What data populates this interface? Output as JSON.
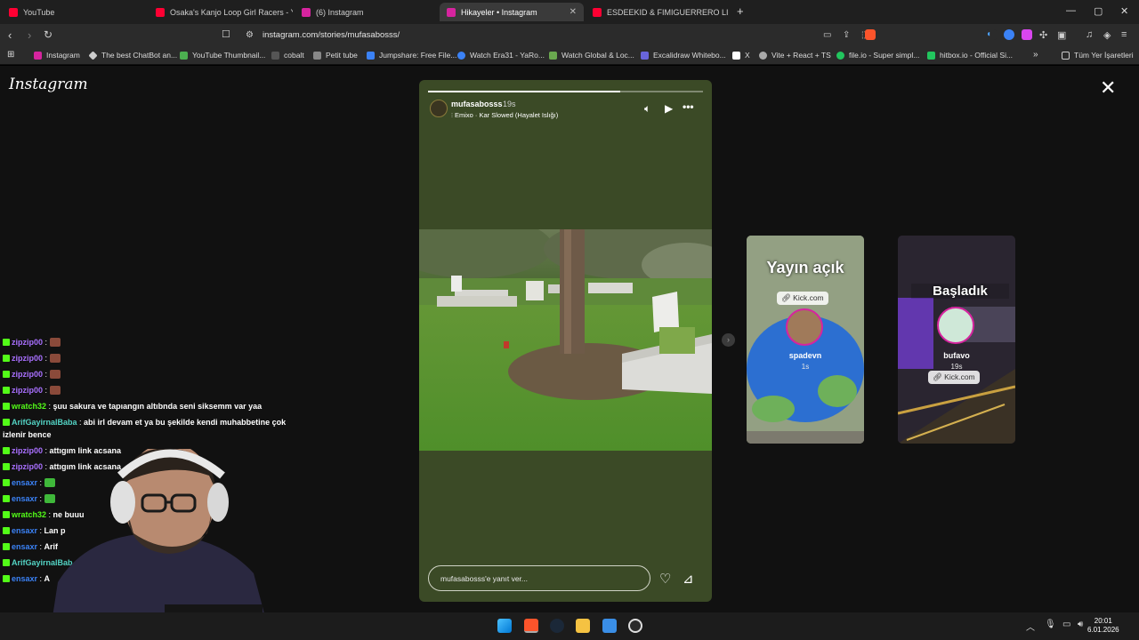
{
  "browser": {
    "tabs": [
      {
        "label": "YouTube",
        "color": "#ff0033"
      },
      {
        "label": "Osaka's Kanjo Loop Girl Racers - You",
        "color": "#ff0033"
      },
      {
        "label": "(6) Instagram",
        "color": "#d6249f"
      },
      {
        "label": "Hikayeler • Instagram",
        "color": "#d6249f",
        "active": true
      },
      {
        "label": "ESDEEKID & FIMIGUERRERO LIVE @",
        "color": "#ff0033"
      }
    ],
    "new_tab": "+",
    "url": "instagram.com/stories/mufasabosss/",
    "bookmarks": [
      {
        "label": "Instagram",
        "color": "#d6249f"
      },
      {
        "label": "The best ChatBot an...",
        "color": "#cccccc"
      },
      {
        "label": "YouTube Thumbnail...",
        "color": "#4caf50"
      },
      {
        "label": "cobalt",
        "color": "#888888"
      },
      {
        "label": "Petit tube",
        "color": "#888888"
      },
      {
        "label": "Jumpshare: Free File...",
        "color": "#3b82f6"
      },
      {
        "label": "Watch Era31 - YaRo...",
        "color": "#3b82f6"
      },
      {
        "label": "Watch Global & Loc...",
        "color": "#6aa84f"
      },
      {
        "label": "Excalidraw Whitebo...",
        "color": "#6965db"
      },
      {
        "label": "X",
        "color": "#ffffff"
      },
      {
        "label": "Vite + React + TS",
        "color": "#aaaaaa"
      },
      {
        "label": "file.io - Super simpl...",
        "color": "#22c55e"
      },
      {
        "label": "hitbox.io - Official Si...",
        "color": "#22c55e"
      }
    ],
    "bookmarks_more": "»",
    "all_bookmarks": "Tüm Yer İşaretleri"
  },
  "instagram": {
    "logo": "Instagram",
    "close": "✕",
    "story": {
      "progress": 0.7,
      "username": "mufasabosss",
      "time": "19s",
      "song": "Emixo · Kar Slowed (Hayalet Islığı)",
      "reply_placeholder": "mufasabosss'e yanıt ver..."
    },
    "side_stories": [
      {
        "title": "Yayın açık",
        "chip": "Kick.com",
        "username": "spadevn",
        "time": "1s"
      },
      {
        "title": "Başladık",
        "chip": "Kick.com",
        "username": "bufavo",
        "time": "19s"
      }
    ]
  },
  "chat": [
    {
      "user": "zipzip00",
      "color": "#a970ff",
      "text": "",
      "emote": true
    },
    {
      "user": "zipzip00",
      "color": "#a970ff",
      "text": "",
      "emote": true
    },
    {
      "user": "zipzip00",
      "color": "#a970ff",
      "text": "",
      "emote": true
    },
    {
      "user": "zipzip00",
      "color": "#a970ff",
      "text": "",
      "emote": true
    },
    {
      "user": "wratch32",
      "color": "#53fc18",
      "text": "şuu sakura ve tapıangın altıbnda seni siksemm var yaa"
    },
    {
      "user": "ArifGayirnalBaba",
      "color": "#53d3c4",
      "text": "abi irl devam et ya bu şekilde kendi muhabbetine çok",
      "cont": "izlenir bence"
    },
    {
      "user": "zipzip00",
      "color": "#a970ff",
      "text": "attıgım link acsana"
    },
    {
      "user": "zipzip00",
      "color": "#a970ff",
      "text": "attıgım link acsana"
    },
    {
      "user": "ensaxr",
      "color": "#3b82f6",
      "text": "",
      "emote": true
    },
    {
      "user": "ensaxr",
      "color": "#3b82f6",
      "text": "",
      "emote": true
    },
    {
      "user": "wratch32",
      "color": "#53fc18",
      "text": "ne buuu"
    },
    {
      "user": "ensaxr",
      "color": "#3b82f6",
      "text": "Lan p"
    },
    {
      "user": "ensaxr",
      "color": "#3b82f6",
      "text": "Arif"
    },
    {
      "user": "ArifGayirnalBab",
      "color": "#53d3c4",
      "text": ""
    },
    {
      "user": "ensaxr",
      "color": "#3b82f6",
      "text": "A"
    }
  ],
  "taskbar": {
    "time": "20:01",
    "date": "6.01.2026"
  }
}
